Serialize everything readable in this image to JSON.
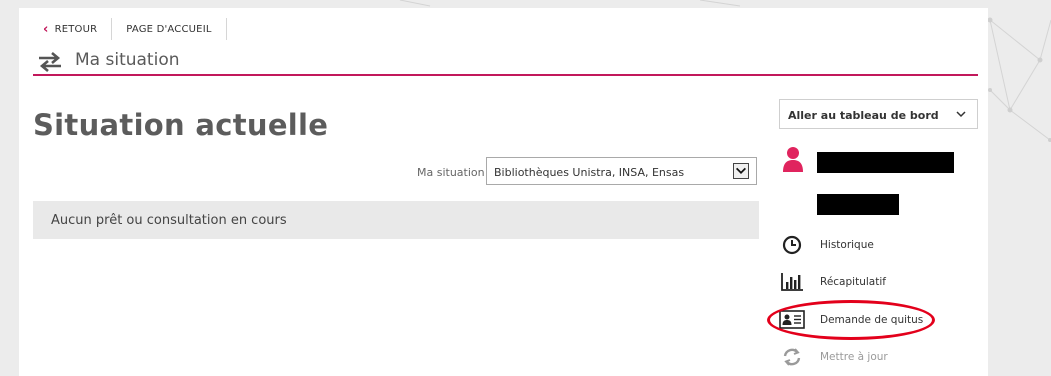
{
  "nav": {
    "back_label": "RETOUR",
    "home_label": "PAGE D'ACCUEIL"
  },
  "section": {
    "title": "Ma situation"
  },
  "main": {
    "title": "Situation actuelle",
    "situation_label": "Ma situation",
    "situation_value": "Bibliothèques Unistra, INSA, Ensas",
    "notice": "Aucun prêt ou consultation en cours"
  },
  "sidebar": {
    "dashboard_label": "Aller au tableau de bord",
    "items": [
      {
        "label": "Historique",
        "icon": "clock-icon",
        "enabled": true
      },
      {
        "label": "Récapitulatif",
        "icon": "bar-chart-icon",
        "enabled": true
      },
      {
        "label": "Demande de quitus",
        "icon": "id-card-icon",
        "enabled": true,
        "annotated": true
      },
      {
        "label": "Mettre à jour",
        "icon": "refresh-icon",
        "enabled": false
      }
    ]
  },
  "colors": {
    "accent": "#c2185b",
    "annotation": "#e3001b",
    "notice_bg": "#e9e9e9"
  }
}
